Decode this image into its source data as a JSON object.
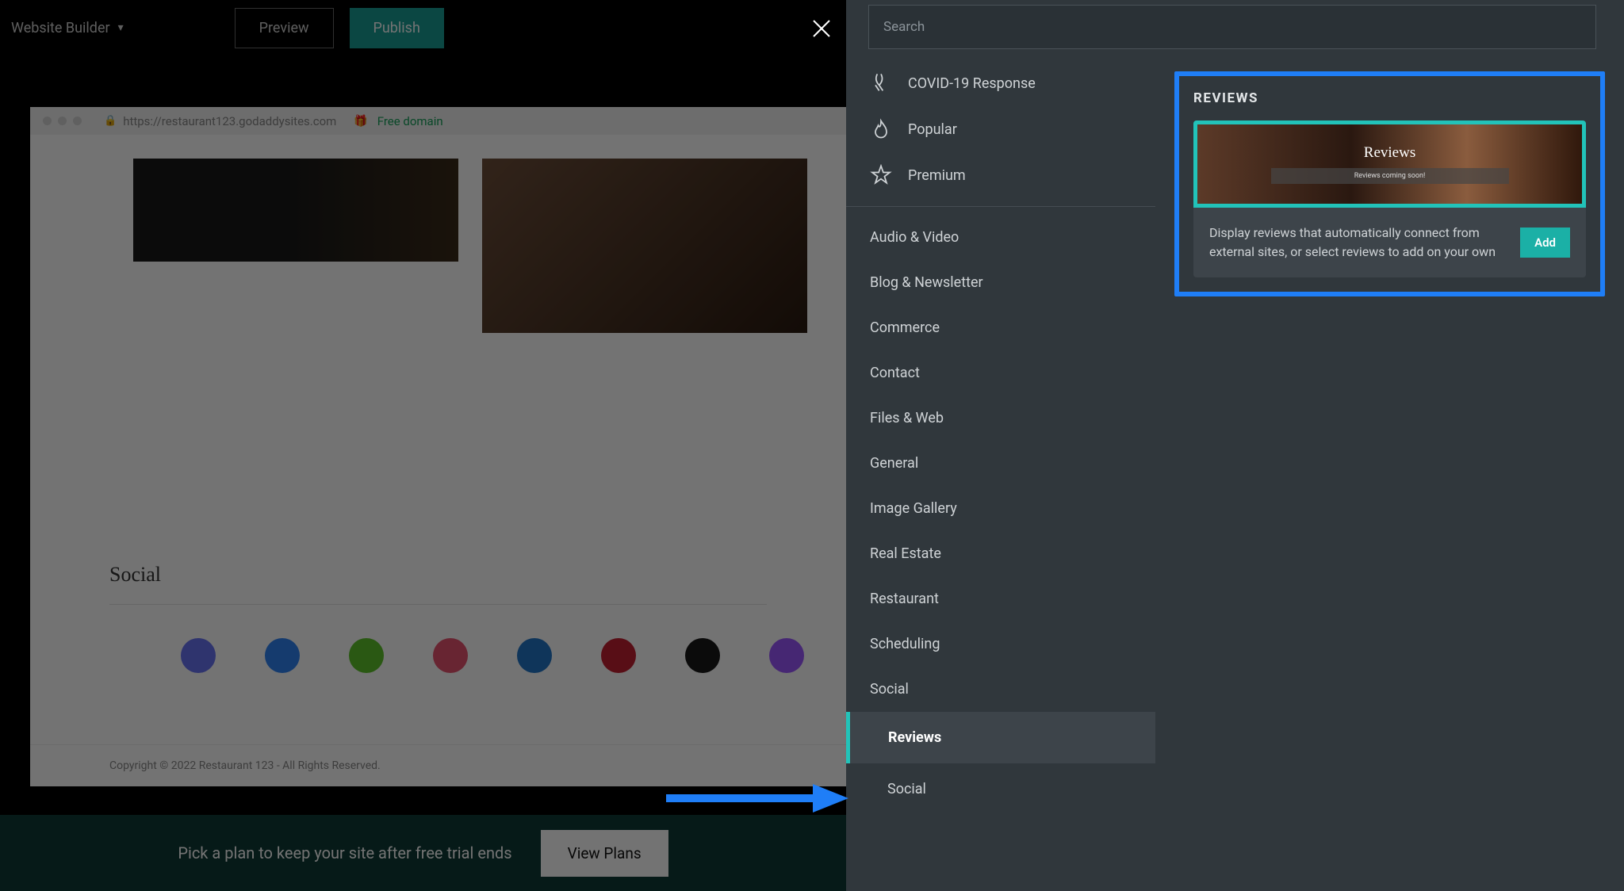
{
  "header": {
    "brand": "Website Builder",
    "preview": "Preview",
    "publish": "Publish"
  },
  "canvas": {
    "url": "https://restaurant123.godaddysites.com",
    "freeDomain": "Free domain",
    "socialTitle": "Social",
    "copyright": "Copyright © 2022 Restaurant 123 - All Rights Reserved."
  },
  "planBar": {
    "message": "Pick a plan to keep your site after free trial ends",
    "cta": "View Plans"
  },
  "panel": {
    "searchPlaceholder": "Search",
    "top": {
      "covid": "COVID-19 Response",
      "popular": "Popular",
      "premium": "Premium"
    },
    "categories": [
      "Audio & Video",
      "Blog & Newsletter",
      "Commerce",
      "Contact",
      "Files & Web",
      "General",
      "Image Gallery",
      "Real Estate",
      "Restaurant",
      "Scheduling",
      "Social"
    ],
    "subItems": {
      "reviews": "Reviews",
      "social": "Social"
    }
  },
  "detail": {
    "title": "REVIEWS",
    "previewHeading": "Reviews",
    "previewSub": "Reviews coming soon!",
    "description": "Display reviews that automatically connect from external sites, or select reviews to add on your own",
    "add": "Add"
  }
}
